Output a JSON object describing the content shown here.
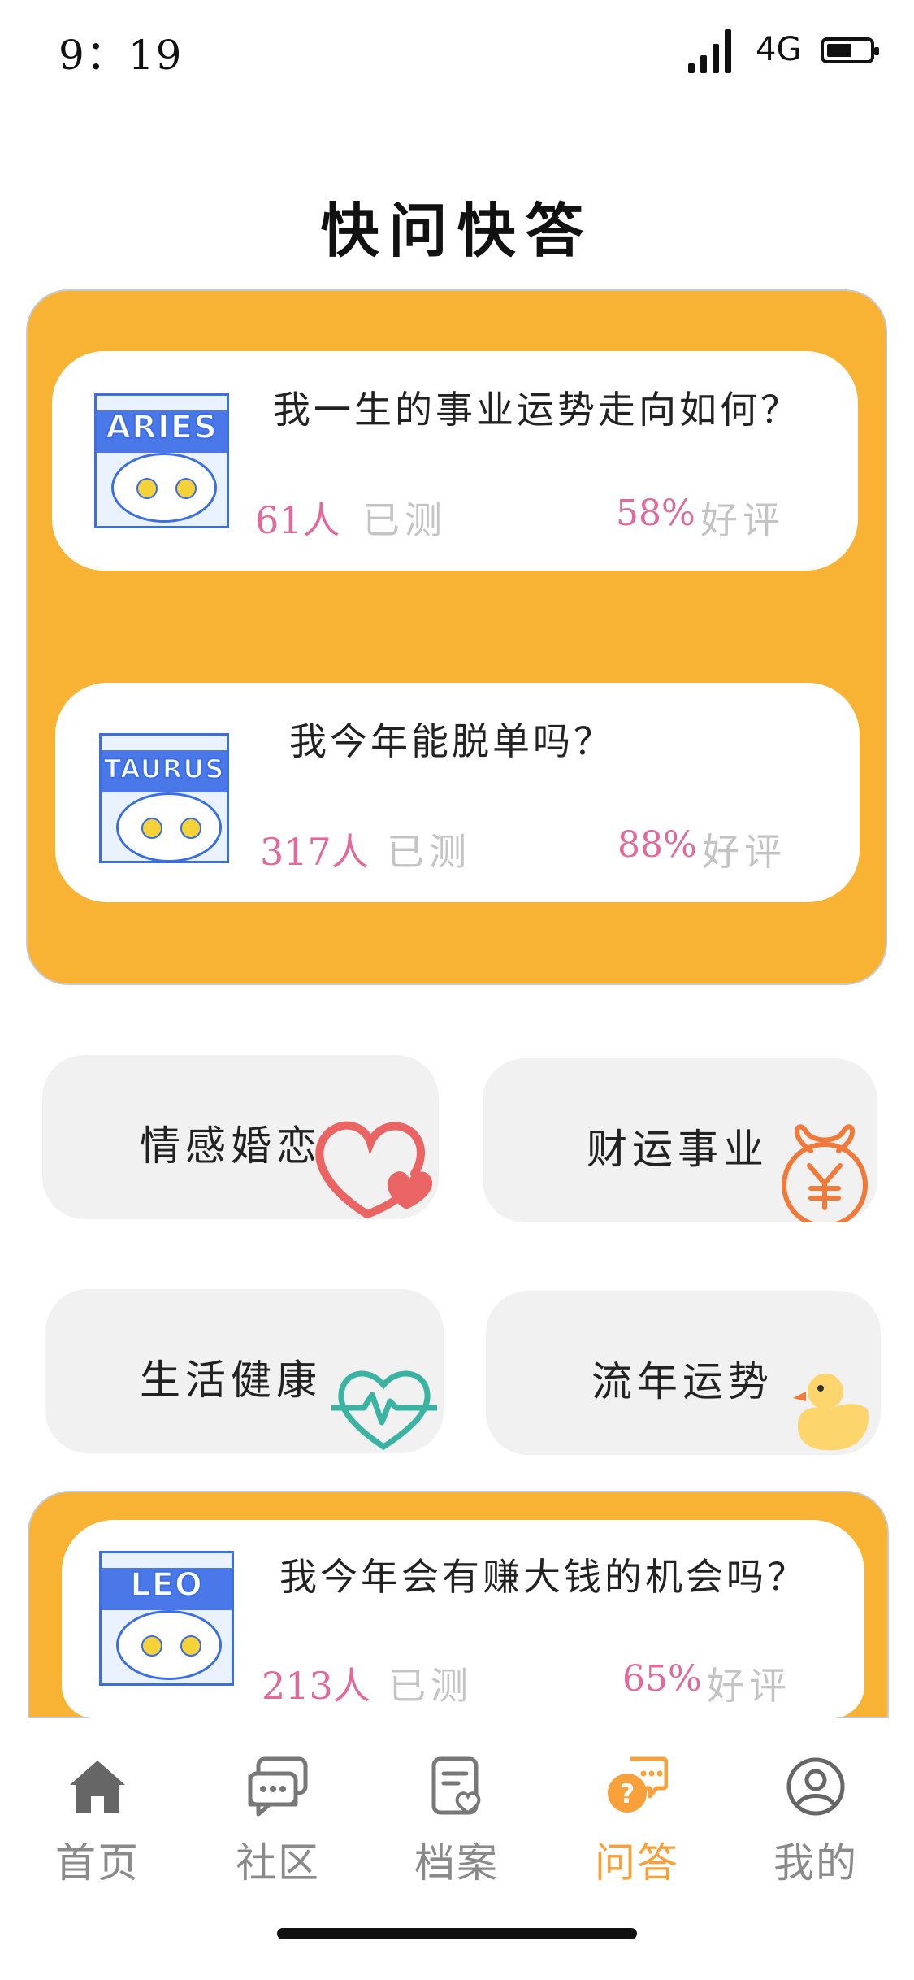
{
  "status_bar": {
    "time": "9：19",
    "network": "4G"
  },
  "page_title": "快问快答",
  "featured_cards": [
    {
      "title": "我一生的事业运势走向如何？",
      "count": "61人",
      "count_label": "已测",
      "rating": "58%",
      "rating_label": "好评",
      "avatar_text": "ARIES"
    },
    {
      "title": "我今年能脱单吗？",
      "count": "317人",
      "count_label": "已测",
      "rating": "88%",
      "rating_label": "好评",
      "avatar_text": "TAURUS"
    }
  ],
  "categories": [
    {
      "label": "情感婚恋",
      "icon": "heart-icon"
    },
    {
      "label": "财运事业",
      "icon": "money-bag-icon"
    },
    {
      "label": "生活健康",
      "icon": "heartbeat-icon"
    },
    {
      "label": "流年运势",
      "icon": "duck-icon"
    }
  ],
  "bottom_card": {
    "title": "我今年会有赚大钱的机会吗？",
    "count": "213人",
    "count_label": "已测",
    "rating": "65%",
    "rating_label": "好评",
    "avatar_text": "LEO"
  },
  "nav": [
    {
      "label": "首页",
      "icon": "home-icon",
      "active": false
    },
    {
      "label": "社区",
      "icon": "chat-icon",
      "active": false
    },
    {
      "label": "档案",
      "icon": "file-icon",
      "active": false
    },
    {
      "label": "问答",
      "icon": "qa-icon",
      "active": true
    },
    {
      "label": "我的",
      "icon": "profile-icon",
      "active": false
    }
  ],
  "colors": {
    "accent": "#f8b334",
    "pink": "#e26a9b",
    "active_nav": "#f8a13a",
    "muted": "#c4c4c4"
  }
}
